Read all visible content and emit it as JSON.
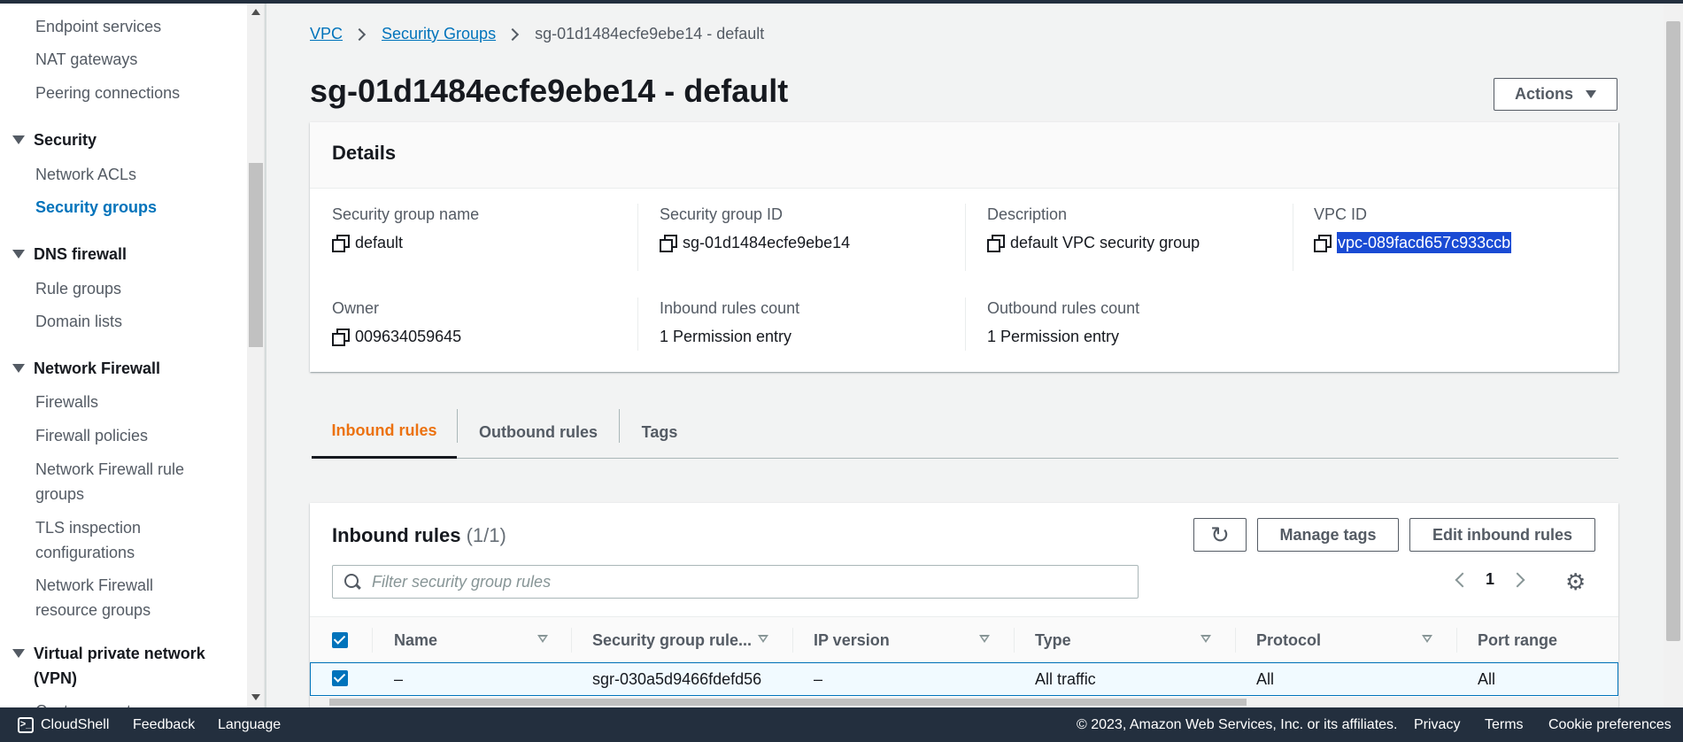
{
  "sidebar": {
    "items": [
      {
        "label": "Endpoint services"
      },
      {
        "label": "NAT gateways"
      },
      {
        "label": "Peering connections"
      }
    ],
    "sections": [
      {
        "label": "Security",
        "items": [
          "Network ACLs",
          "Security groups"
        ]
      },
      {
        "label": "DNS firewall",
        "items": [
          "Rule groups",
          "Domain lists"
        ]
      },
      {
        "label": "Network Firewall",
        "items": [
          "Firewalls",
          "Firewall policies",
          "Network Firewall rule groups",
          "TLS inspection configurations",
          "Network Firewall resource groups"
        ]
      },
      {
        "label": "Virtual private network (VPN)",
        "items": [
          "Customer gateways"
        ]
      }
    ]
  },
  "breadcrumb": {
    "vpc": "VPC",
    "security_groups": "Security Groups",
    "current": "sg-01d1484ecfe9ebe14 - default"
  },
  "page": {
    "title": "sg-01d1484ecfe9ebe14 - default",
    "actions_label": "Actions"
  },
  "details": {
    "header": "Details",
    "fields": [
      {
        "label": "Security group name",
        "value": "default"
      },
      {
        "label": "Security group ID",
        "value": "sg-01d1484ecfe9ebe14"
      },
      {
        "label": "Description",
        "value": "default VPC security group"
      },
      {
        "label": "VPC ID",
        "value": "vpc-089facd657c933ccb"
      },
      {
        "label": "Owner",
        "value": "009634059645"
      },
      {
        "label": "Inbound rules count",
        "value": "1 Permission entry"
      },
      {
        "label": "Outbound rules count",
        "value": "1 Permission entry"
      }
    ]
  },
  "tabs": [
    {
      "label": "Inbound rules"
    },
    {
      "label": "Outbound rules"
    },
    {
      "label": "Tags"
    }
  ],
  "rules": {
    "title": "Inbound rules",
    "count": "(1/1)",
    "manage_tags_label": "Manage tags",
    "edit_label": "Edit inbound rules",
    "filter_placeholder": "Filter security group rules",
    "page_number": "1",
    "columns": [
      "Name",
      "Security group rule...",
      "IP version",
      "Type",
      "Protocol",
      "Port range"
    ],
    "rows": [
      {
        "name": "–",
        "rule_id": "sgr-030a5d9466fdefd56",
        "ip_version": "–",
        "type": "All traffic",
        "protocol": "All",
        "port_range": "All"
      }
    ]
  },
  "footer": {
    "cloudshell": "CloudShell",
    "feedback": "Feedback",
    "language": "Language",
    "copyright": "© 2023, Amazon Web Services, Inc. or its affiliates.",
    "privacy": "Privacy",
    "terms": "Terms",
    "cookie": "Cookie preferences"
  },
  "colors": {
    "link": "#0073bb",
    "active_tab": "#ec7211",
    "footer_bg": "#232f3e",
    "selection_highlight": "#1a4bd4"
  }
}
